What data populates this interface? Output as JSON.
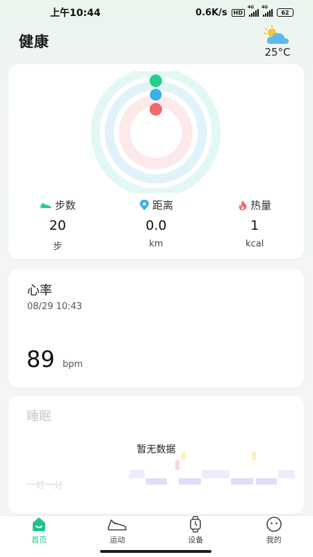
{
  "status_bar": {
    "time": "上午10:44",
    "speed": "0.6K/s",
    "hd": "HD",
    "signal1": "4G",
    "signal2": "4G",
    "battery": "62"
  },
  "header": {
    "title": "健康",
    "temperature": "25°C",
    "weather_icon": "partly-cloudy-icon"
  },
  "activity": {
    "rings": {
      "steps_progress": 0.0,
      "distance_progress": 0.0,
      "calories_progress": 0.0
    },
    "colors": {
      "steps": "#23d18b",
      "distance": "#3ab0e8",
      "calories": "#f4676a"
    },
    "stats": [
      {
        "icon": "shoe-icon",
        "label": "步数",
        "value": "20",
        "unit": "步"
      },
      {
        "icon": "location-pin-icon",
        "label": "距离",
        "value": "0.0",
        "unit": "km"
      },
      {
        "icon": "fire-icon",
        "label": "热量",
        "value": "1",
        "unit": "kcal"
      }
    ]
  },
  "heart_rate": {
    "title": "心率",
    "time": "08/29 10:43",
    "value": "89",
    "unit": "bpm"
  },
  "sleep": {
    "title": "睡眠",
    "empty_message": "暂无数据",
    "duration_hours": "一",
    "hours_unit": "时",
    "duration_minutes": "一",
    "minutes_unit": "分"
  },
  "tabbar": {
    "items": [
      {
        "label": "首页",
        "icon": "home-icon",
        "active": true
      },
      {
        "label": "运动",
        "icon": "sneaker-icon",
        "active": false
      },
      {
        "label": "设备",
        "icon": "watch-icon",
        "active": false
      },
      {
        "label": "我的",
        "icon": "profile-face-icon",
        "active": false
      }
    ]
  }
}
